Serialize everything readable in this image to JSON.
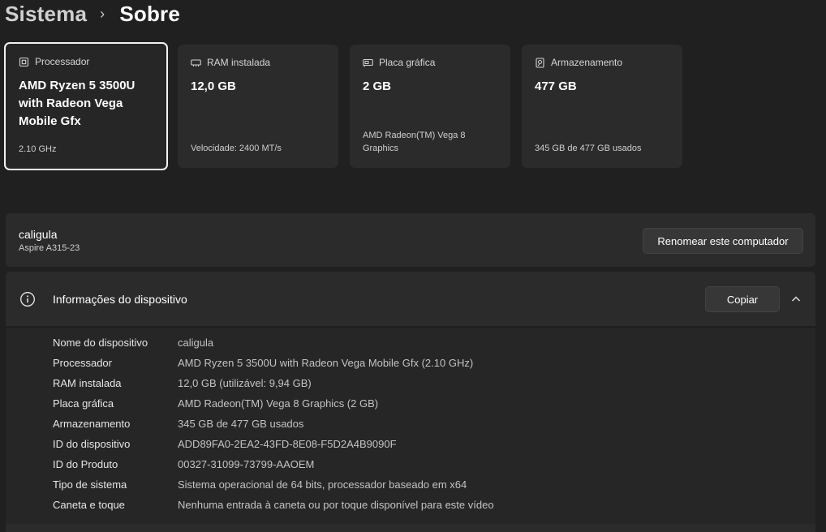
{
  "breadcrumb": {
    "parent": "Sistema",
    "separator": "›",
    "current": "Sobre"
  },
  "specs": [
    {
      "label": "Processador",
      "value": "AMD Ryzen 5 3500U with Radeon Vega Mobile Gfx",
      "sub": "2.10 GHz",
      "icon": "processor-icon"
    },
    {
      "label": "RAM instalada",
      "value": "12,0 GB",
      "sub": "Velocidade: 2400 MT/s",
      "icon": "ram-icon"
    },
    {
      "label": "Placa gráfica",
      "value": "2 GB",
      "sub": "AMD Radeon(TM) Vega 8 Graphics",
      "icon": "gpu-icon"
    },
    {
      "label": "Armazenamento",
      "value": "477 GB",
      "sub": "345 GB de 477 GB usados",
      "icon": "storage-icon"
    }
  ],
  "computer": {
    "name": "caligula",
    "model": "Aspire A315-23",
    "rename_label": "Renomear este computador"
  },
  "device_info": {
    "title": "Informações do dispositivo",
    "copy_label": "Copiar",
    "rows": [
      {
        "label": "Nome do dispositivo",
        "value": "caligula"
      },
      {
        "label": "Processador",
        "value": "AMD Ryzen 5 3500U with Radeon Vega Mobile Gfx (2.10 GHz)"
      },
      {
        "label": "RAM instalada",
        "value": "12,0 GB (utilizável: 9,94 GB)"
      },
      {
        "label": "Placa gráfica",
        "value": "AMD Radeon(TM) Vega 8 Graphics (2 GB)"
      },
      {
        "label": "Armazenamento",
        "value": "345 GB de 477 GB usados"
      },
      {
        "label": "ID do dispositivo",
        "value": "ADD89FA0-2EA2-43FD-8E08-F5D2A4B9090F"
      },
      {
        "label": "ID do Produto",
        "value": "00327-31099-73799-AAOEM"
      },
      {
        "label": "Tipo de sistema",
        "value": "Sistema operacional de 64 bits, processador baseado em x64"
      },
      {
        "label": "Caneta e toque",
        "value": "Nenhuma entrada à caneta ou por toque disponível para este vídeo"
      }
    ]
  }
}
